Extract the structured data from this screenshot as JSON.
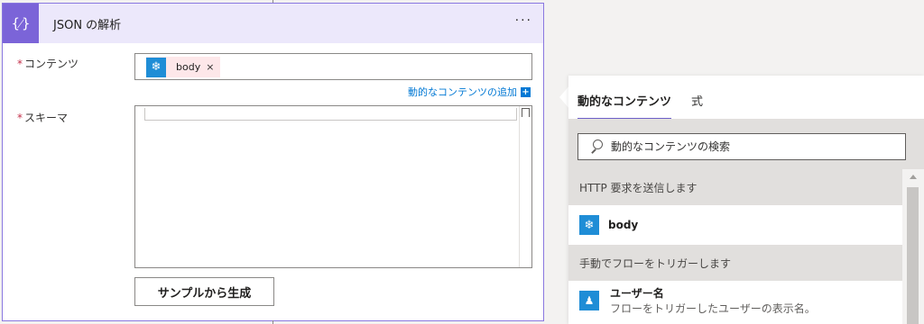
{
  "action_card": {
    "icon_glyph": "{⁄}",
    "title": "JSON の解析",
    "menu_glyph": "···",
    "fields": {
      "content": {
        "required_mark": "*",
        "label": "コンテンツ",
        "token": {
          "icon_glyph": "❄",
          "label": "body",
          "remove_glyph": "×"
        }
      },
      "add_dynamic_link": "動的なコンテンツの追加",
      "add_dynamic_plus": "+",
      "schema": {
        "required_mark": "*",
        "label": "スキーマ",
        "value": ""
      }
    },
    "generate_button": "サンプルから生成"
  },
  "dynamic_panel": {
    "tabs": [
      {
        "label": "動的なコンテンツ",
        "active": true
      },
      {
        "label": "式",
        "active": false
      }
    ],
    "search_placeholder": "動的なコンテンツの検索",
    "sections": [
      {
        "header": "HTTP 要求を送信します",
        "items": [
          {
            "icon_glyph": "❄",
            "label": "body"
          }
        ]
      },
      {
        "header": "手動でフローをトリガーします",
        "items": [
          {
            "icon_glyph": "♟",
            "label": "ユーザー名",
            "description": "フローをトリガーしたユーザーの表示名。"
          }
        ]
      }
    ]
  },
  "colors": {
    "accent": "#7b64d8",
    "header_bg": "#ece8fb",
    "link": "#0078d4",
    "token_bg": "#fde7e9",
    "required": "#c4314b"
  }
}
